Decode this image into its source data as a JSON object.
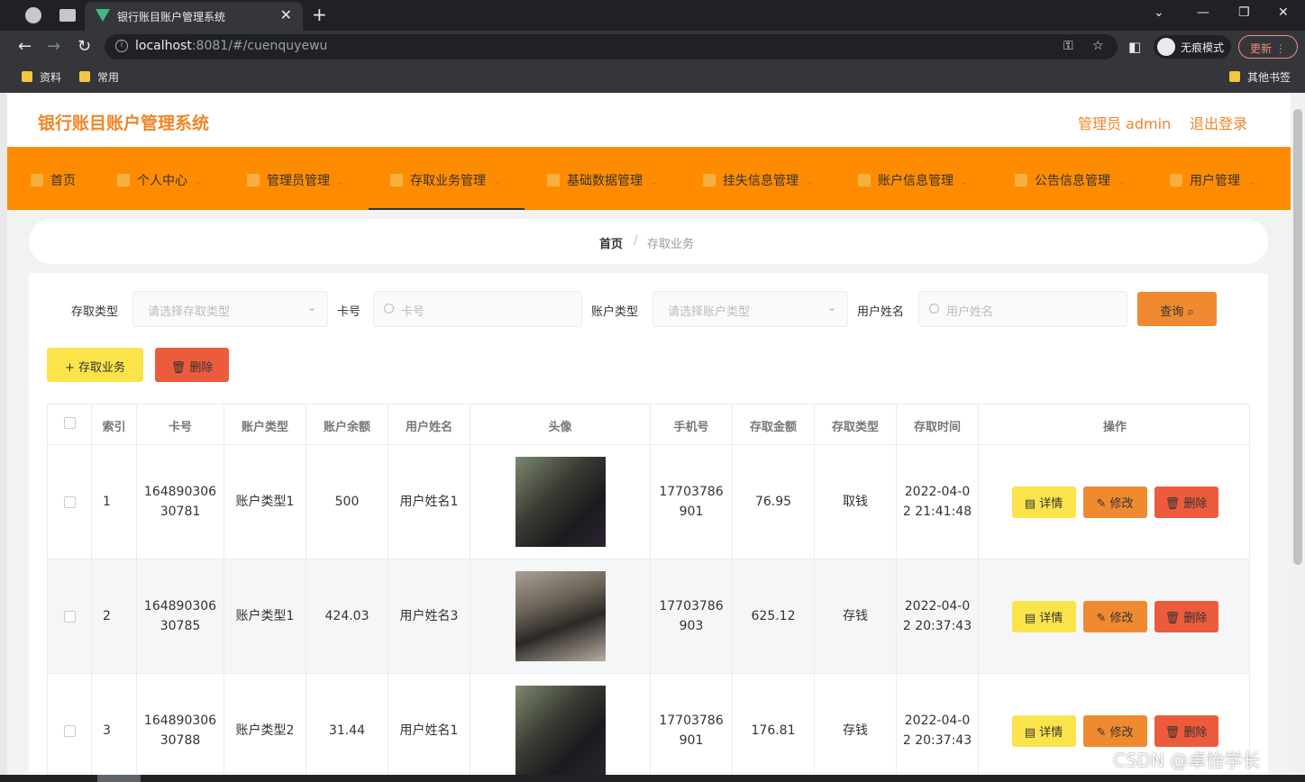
{
  "browser": {
    "tab_title": "银行账目账户管理系统",
    "url_host": "localhost",
    "url_rest": ":8081/#/cuenquyewu",
    "incognito_label": "无痕模式",
    "update_label": "更新",
    "bookmarks": [
      "资料",
      "常用"
    ],
    "other_bookmarks": "其他书签"
  },
  "header": {
    "title": "银行账目账户管理系统",
    "user": "管理员 admin",
    "logout": "退出登录"
  },
  "menu": [
    {
      "label": "首页",
      "has_chevron": false
    },
    {
      "label": "个人中心",
      "has_chevron": true
    },
    {
      "label": "管理员管理",
      "has_chevron": true
    },
    {
      "label": "存取业务管理",
      "has_chevron": true,
      "active": true
    },
    {
      "label": "基础数据管理",
      "has_chevron": true
    },
    {
      "label": "挂失信息管理",
      "has_chevron": true
    },
    {
      "label": "账户信息管理",
      "has_chevron": true
    },
    {
      "label": "公告信息管理",
      "has_chevron": true
    },
    {
      "label": "用户管理",
      "has_chevron": true
    }
  ],
  "breadcrumb": {
    "home": "首页",
    "sep": "/",
    "current": "存取业务"
  },
  "filters": {
    "type_label": "存取类型",
    "type_placeholder": "请选择存取类型",
    "card_label": "卡号",
    "card_placeholder": "卡号",
    "acct_type_label": "账户类型",
    "acct_type_placeholder": "请选择账户类型",
    "name_label": "用户姓名",
    "name_placeholder": "用户姓名",
    "query_label": "查询"
  },
  "actions": {
    "add_label": "+ 存取业务",
    "delete_label": "删除"
  },
  "table": {
    "columns": [
      "索引",
      "卡号",
      "账户类型",
      "账户余额",
      "用户姓名",
      "头像",
      "手机号",
      "存取金额",
      "存取类型",
      "存取时间",
      "操作"
    ],
    "rows": [
      {
        "index": "1",
        "card_a": "164890306",
        "card_b": "30781",
        "acct_type": "账户类型1",
        "balance": "500",
        "name": "用户姓名1",
        "avatar": "avatar-photo-1",
        "phone_a": "17703786",
        "phone_b": "901",
        "amount": "76.95",
        "op_type": "取钱",
        "time_a": "2022-04-0",
        "time_b": "2 21:41:48"
      },
      {
        "index": "2",
        "card_a": "164890306",
        "card_b": "30785",
        "acct_type": "账户类型1",
        "balance": "424.03",
        "name": "用户姓名3",
        "avatar": "avatar-photo-2",
        "phone_a": "17703786",
        "phone_b": "903",
        "amount": "625.12",
        "op_type": "存钱",
        "time_a": "2022-04-0",
        "time_b": "2 20:37:43"
      },
      {
        "index": "3",
        "card_a": "164890306",
        "card_b": "30788",
        "acct_type": "账户类型2",
        "balance": "31.44",
        "name": "用户姓名1",
        "avatar": "avatar-photo-1",
        "phone_a": "17703786",
        "phone_b": "901",
        "amount": "176.81",
        "op_type": "存钱",
        "time_a": "2022-04-0",
        "time_b": "2 20:37:43"
      }
    ],
    "row_buttons": {
      "detail": "详情",
      "edit": "修改",
      "delete": "删除"
    }
  },
  "colors": {
    "accent": "#ff8c00",
    "title": "#f0852a",
    "yellow": "#fbe44a",
    "orange": "#f08a30",
    "red": "#ec5c3c"
  },
  "watermark": "CSDN @卓怡学长"
}
